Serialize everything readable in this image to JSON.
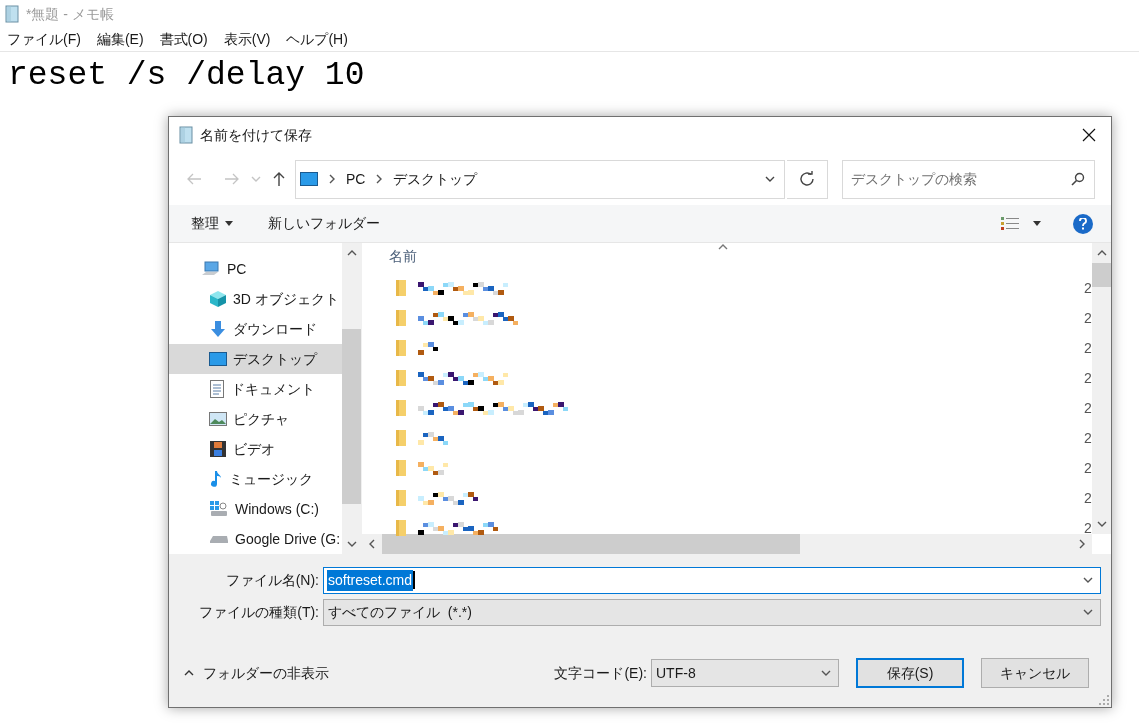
{
  "notepad": {
    "title": "*無題 - メモ帳",
    "menu": [
      "ファイル(F)",
      "編集(E)",
      "書式(O)",
      "表示(V)",
      "ヘルプ(H)"
    ],
    "text": "reset /s /delay 10"
  },
  "dialog": {
    "title": "名前を付けて保存",
    "address": [
      "PC",
      "デスクトップ"
    ],
    "search": {
      "placeholder": "デスクトップの検索"
    },
    "toolbar": {
      "organize": "整理",
      "new_folder": "新しいフォルダー"
    },
    "sidebar": {
      "items": [
        {
          "label": "PC",
          "kind": "pc",
          "selected": false,
          "children": [
            {
              "label": "3D オブジェクト",
              "kind": "cube",
              "selected": false
            },
            {
              "label": "ダウンロード",
              "kind": "download",
              "selected": false
            },
            {
              "label": "デスクトップ",
              "kind": "desktop",
              "selected": true
            },
            {
              "label": "ドキュメント",
              "kind": "document",
              "selected": false
            },
            {
              "label": "ピクチャ",
              "kind": "pictures",
              "selected": false
            },
            {
              "label": "ビデオ",
              "kind": "video",
              "selected": false
            },
            {
              "label": "ミュージック",
              "kind": "music",
              "selected": false
            },
            {
              "label": "Windows (C:)",
              "kind": "windows_drive",
              "selected": false
            },
            {
              "label": "Google Drive (G:",
              "kind": "drive",
              "selected": false
            }
          ]
        }
      ]
    },
    "file_list": {
      "column_1": "名前",
      "rows": [
        {
          "column_2": "2"
        },
        {
          "column_2": "2"
        },
        {
          "column_2": "2"
        },
        {
          "column_2": "2"
        },
        {
          "column_2": "2"
        },
        {
          "column_2": "2"
        },
        {
          "column_2": "2"
        },
        {
          "column_2": "2"
        },
        {
          "column_2": "2"
        }
      ]
    },
    "file_name": {
      "label": "ファイル名(N):",
      "value": "softreset.cmd",
      "value_selected": true
    },
    "file_type": {
      "label": "ファイルの種類(T):",
      "value": "すべてのファイル  (*.*)"
    },
    "hide_folders": "フォルダーの非表示",
    "encoding": {
      "label": "文字コード(E):",
      "value": "UTF-8"
    },
    "buttons": [
      {
        "label": "保存(S)",
        "kind": "primary"
      },
      {
        "label": "キャンセル",
        "kind": "normal"
      }
    ]
  }
}
